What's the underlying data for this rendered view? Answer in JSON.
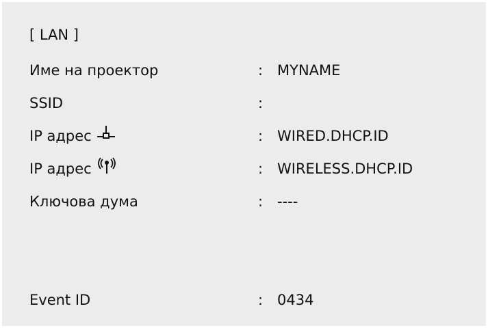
{
  "header": {
    "title": "[ LAN ]"
  },
  "fields": {
    "projector_name": {
      "label": "Име на проектор",
      "separator": ":",
      "value": "MYNAME"
    },
    "ssid": {
      "label": "SSID",
      "separator": ":",
      "value": ""
    },
    "ip_wired": {
      "label": "IP адрес",
      "icon": "wired-lan-icon",
      "separator": ":",
      "value": "WIRED.DHCP.ID"
    },
    "ip_wireless": {
      "label": "IP адрес",
      "icon": "wireless-antenna-icon",
      "separator": ":",
      "value": "WIRELESS.DHCP.ID"
    },
    "keyword": {
      "label": "Ключова дума",
      "separator": ":",
      "value": "----"
    },
    "event_id": {
      "label": "Event ID",
      "separator": ":",
      "value": "0434"
    }
  },
  "colors": {
    "panel_background": "#ececec",
    "text": "#111111"
  }
}
